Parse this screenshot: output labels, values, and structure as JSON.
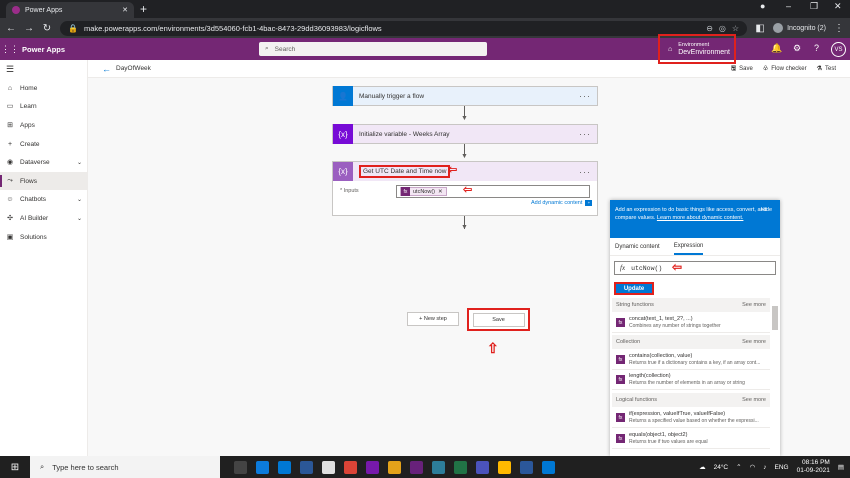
{
  "browser": {
    "tab_title": "Power Apps",
    "url": "make.powerapps.com/environments/3d554060-fcb1-4bac-8473-29dd36093983/logicflows",
    "incognito": "Incognito (2)"
  },
  "header": {
    "app": "Power Apps",
    "search_placeholder": "Search",
    "env_label": "Environment",
    "env_value": "DevEnvironment",
    "avatar": "VS"
  },
  "sidebar": {
    "items": [
      {
        "label": "Home"
      },
      {
        "label": "Learn"
      },
      {
        "label": "Apps"
      },
      {
        "label": "Create"
      },
      {
        "label": "Dataverse"
      },
      {
        "label": "Flows"
      },
      {
        "label": "Chatbots"
      },
      {
        "label": "AI Builder"
      },
      {
        "label": "Solutions"
      }
    ]
  },
  "cmdbar": {
    "flow_name": "DayOfWeek",
    "save": "Save",
    "checker": "Flow checker",
    "test": "Test"
  },
  "flow": {
    "steps": [
      {
        "label": "Manually trigger a flow"
      },
      {
        "label": "Initialize variable - Weeks Array"
      },
      {
        "label": "Get UTC Date and Time now"
      }
    ],
    "inputs_label": "* Inputs",
    "token": "utcNow()",
    "dynamic_link": "Add dynamic content",
    "new_step": "+ New step",
    "save": "Save"
  },
  "panel": {
    "intro": "Add an expression to do basic things like access, convert, and compare values.",
    "learn_more": "Learn more about dynamic content.",
    "hide": "Hide",
    "tab_dynamic": "Dynamic content",
    "tab_expression": "Expression",
    "expression": "utcNow()",
    "update": "Update",
    "see_more": "See more",
    "sections": [
      {
        "title": "String functions"
      },
      {
        "title": "Collection"
      },
      {
        "title": "Logical functions"
      }
    ],
    "functions": [
      {
        "name": "concat(text_1, text_2?, ...)",
        "desc": "Combines any number of strings together"
      },
      {
        "name": "contains(collection, value)",
        "desc": "Returns true if a dictionary contains a key, if an array cont..."
      },
      {
        "name": "length(collection)",
        "desc": "Returns the number of elements in an array or string"
      },
      {
        "name": "if(expression, valueIfTrue, valueIfFalse)",
        "desc": "Returns a specified value based on whether the expressi..."
      },
      {
        "name": "equals(object1, object2)",
        "desc": "Returns true if two values are equal"
      }
    ]
  },
  "taskbar": {
    "search": "Type here to search",
    "temp": "24°C",
    "lang": "ENG",
    "time": "08:16 PM",
    "date": "01-09-2021"
  }
}
